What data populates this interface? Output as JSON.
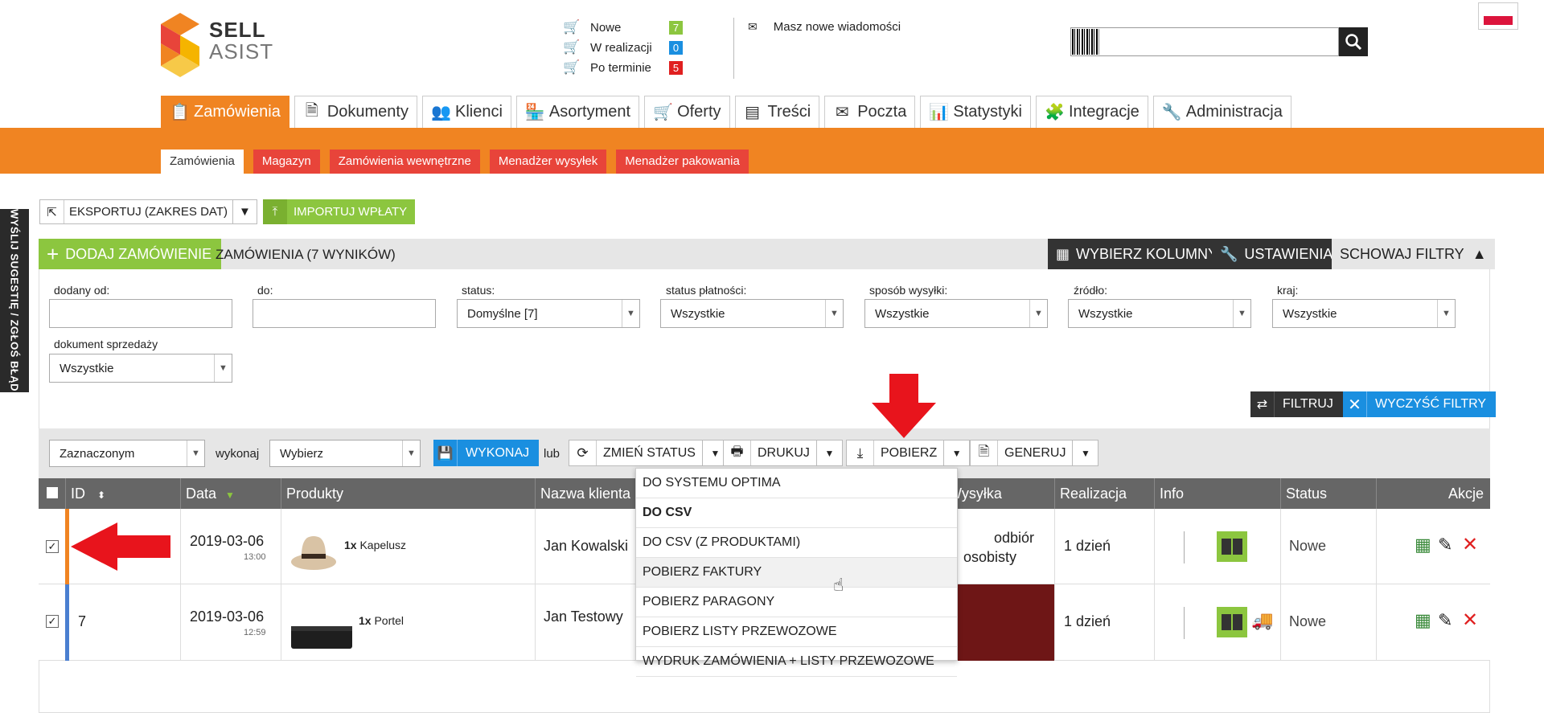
{
  "logo": {
    "line1": "SELL",
    "line2": "ASIST"
  },
  "order_counts": [
    {
      "label": "Nowe",
      "count": "7",
      "color": "#8cc63f"
    },
    {
      "label": "W realizacji",
      "count": "0",
      "color": "#1a8fe0"
    },
    {
      "label": "Po terminie",
      "count": "5",
      "color": "#e02020"
    }
  ],
  "messages": {
    "text": "Masz nowe wiadomości"
  },
  "nav": {
    "tabs": [
      {
        "label": "Zamówienia",
        "icon": "clipboard-icon"
      },
      {
        "label": "Dokumenty",
        "icon": "document-icon"
      },
      {
        "label": "Klienci",
        "icon": "people-icon"
      },
      {
        "label": "Asortyment",
        "icon": "store-icon"
      },
      {
        "label": "Oferty",
        "icon": "cart-add-icon"
      },
      {
        "label": "Treści",
        "icon": "content-icon"
      },
      {
        "label": "Poczta",
        "icon": "mail-icon"
      },
      {
        "label": "Statystyki",
        "icon": "chart-icon"
      },
      {
        "label": "Integracje",
        "icon": "puzzle-icon"
      },
      {
        "label": "Administracja",
        "icon": "wrench-icon"
      }
    ],
    "subtabs": [
      "Zamówienia",
      "Magazyn",
      "Zamówienia wewnętrzne",
      "Menadżer wysyłek",
      "Menadżer pakowania"
    ]
  },
  "feedback": "WYŚLIJ SUGESTIĘ / ZGŁOŚ BŁĄD",
  "toolbar": {
    "export": "EKSPORTUJ (ZAKRES DAT)",
    "import": "IMPORTUJ WPŁATY"
  },
  "panel": {
    "add": "DODAJ ZAMÓWIENIE",
    "results": "ZAMÓWIENIA (7 WYNIKÓW)",
    "columns": "WYBIERZ KOLUMNY",
    "settings": "USTAWIENIA",
    "hide_filters": "SCHOWAJ FILTRY"
  },
  "filters": {
    "added_from": "dodany od:",
    "to": "do:",
    "status": {
      "label": "status:",
      "value": "Domyślne [7]"
    },
    "payment": {
      "label": "status płatności:",
      "value": "Wszystkie"
    },
    "shipping": {
      "label": "sposób wysyłki:",
      "value": "Wszystkie"
    },
    "source": {
      "label": "źródło:",
      "value": "Wszystkie"
    },
    "country": {
      "label": "kraj:",
      "value": "Wszystkie"
    },
    "sales_doc": {
      "label": "dokument sprzedaży",
      "value": "Wszystkie"
    },
    "filter_btn": "FILTRUJ",
    "clear_btn": "WYCZYŚĆ FILTRY"
  },
  "actions": {
    "scope": "Zaznaczonym",
    "execute_label": "wykonaj",
    "action": "Wybierz",
    "run": "WYKONAJ",
    "or": "lub",
    "change_status": "ZMIEŃ STATUS",
    "print": "DRUKUJ",
    "download": "POBIERZ",
    "generate": "GENERUJ"
  },
  "table": {
    "headers": [
      "ID",
      "Data",
      "Produkty",
      "Nazwa klienta",
      "Wysyłka",
      "Realizacja",
      "Info",
      "Status",
      "Akcje"
    ],
    "rows": [
      {
        "id": "",
        "date": "2019-03-06",
        "time": "13:00",
        "qty": "1x",
        "product": "Kapelusz",
        "client": "Jan Kowalski",
        "shipping_line1": "odbiór",
        "shipping_line2": "osobisty",
        "realization": "1 dzień",
        "status": "Nowe",
        "stripe": "#f08422"
      },
      {
        "id": "7",
        "date": "2019-03-06",
        "time": "12:59",
        "qty": "1x",
        "product": "Portel",
        "client": "Jan Testowy",
        "shipping_line1": "",
        "shipping_line2": "",
        "realization": "1 dzień",
        "status": "Nowe",
        "stripe": "#4a7fd0"
      }
    ]
  },
  "download_menu": [
    {
      "label": "DO SYSTEMU OPTIMA"
    },
    {
      "label": "DO CSV"
    },
    {
      "label": "DO CSV (Z PRODUKTAMI)"
    },
    {
      "label": "POBIERZ FAKTURY"
    },
    {
      "label": "POBIERZ PARAGONY"
    },
    {
      "label": "POBIERZ LISTY PRZEWOZOWE"
    },
    {
      "label": "WYDRUK ZAMÓWIENIA + LISTY PRZEWOZOWE"
    }
  ],
  "colors": {
    "accent": "#f08422",
    "green": "#8cc63f",
    "blue": "#1a8fe0",
    "red_annotation": "#e8141c"
  }
}
